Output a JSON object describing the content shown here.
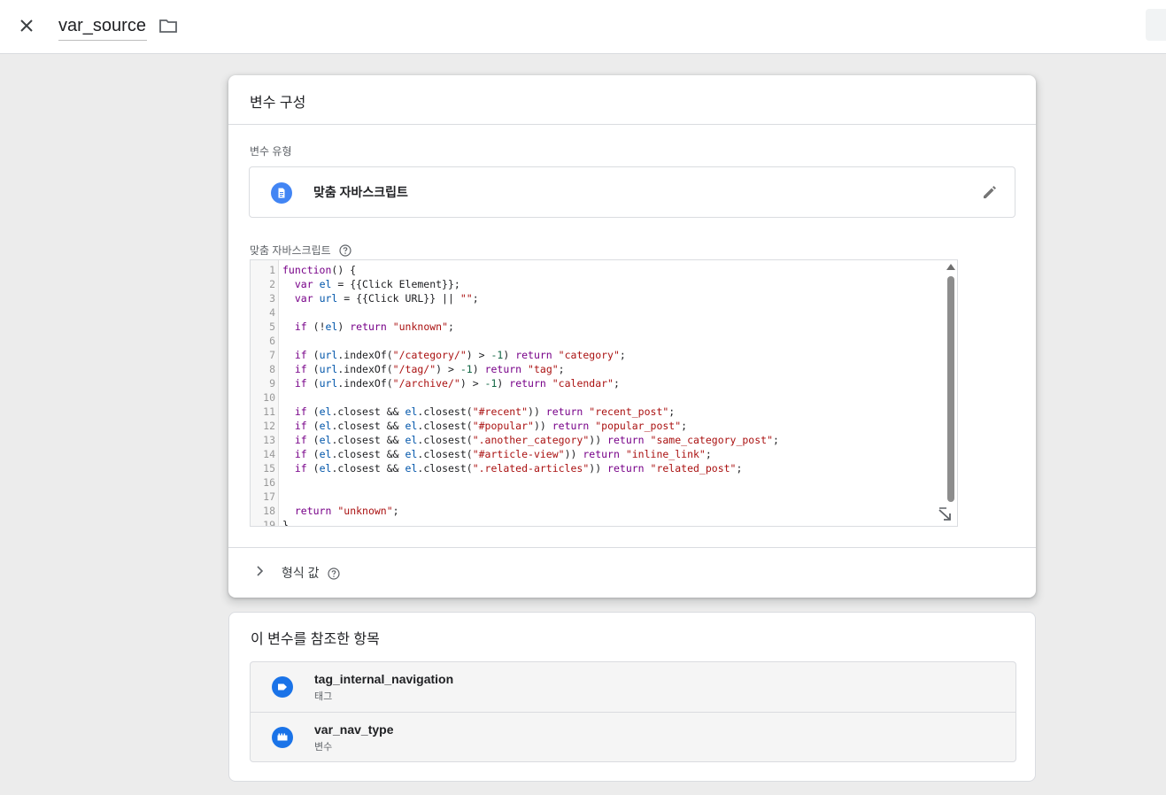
{
  "topbar": {
    "title": "var_source",
    "close_icon": "close-icon",
    "folder_icon": "folder-icon"
  },
  "config": {
    "heading": "변수 구성",
    "type_label": "변수 유형",
    "type_name": "맞춤 자바스크립트",
    "type_icon": "document-icon",
    "edit_icon": "pencil-icon",
    "script_label": "맞춤 자바스크립트",
    "help_icon": "help-icon",
    "format_label": "형식 값"
  },
  "code": {
    "lines": [
      "function() {",
      "  var el = {{Click Element}};",
      "  var url = {{Click URL}} || \"\";",
      "",
      "  if (!el) return \"unknown\";",
      "",
      "  if (url.indexOf(\"/category/\") > -1) return \"category\";",
      "  if (url.indexOf(\"/tag/\") > -1) return \"tag\";",
      "  if (url.indexOf(\"/archive/\") > -1) return \"calendar\";",
      "",
      "  if (el.closest && el.closest(\"#recent\")) return \"recent_post\";",
      "  if (el.closest && el.closest(\"#popular\")) return \"popular_post\";",
      "  if (el.closest && el.closest(\".another_category\")) return \"same_category_post\";",
      "  if (el.closest && el.closest(\"#article-view\")) return \"inline_link\";",
      "  if (el.closest && el.closest(\".related-articles\")) return \"related_post\";",
      "",
      "",
      "  return \"unknown\";",
      "}"
    ]
  },
  "references": {
    "heading": "이 변수를 참조한 항목",
    "items": [
      {
        "name": "tag_internal_navigation",
        "type": "태그",
        "icon": "tag-icon"
      },
      {
        "name": "var_nav_type",
        "type": "변수",
        "icon": "variable-icon"
      }
    ]
  },
  "colors": {
    "accent": "#1a73e8",
    "type_icon": "#4285f4",
    "keyword": "#770088",
    "variable": "#0055aa",
    "string": "#aa1111",
    "number": "#116644"
  }
}
